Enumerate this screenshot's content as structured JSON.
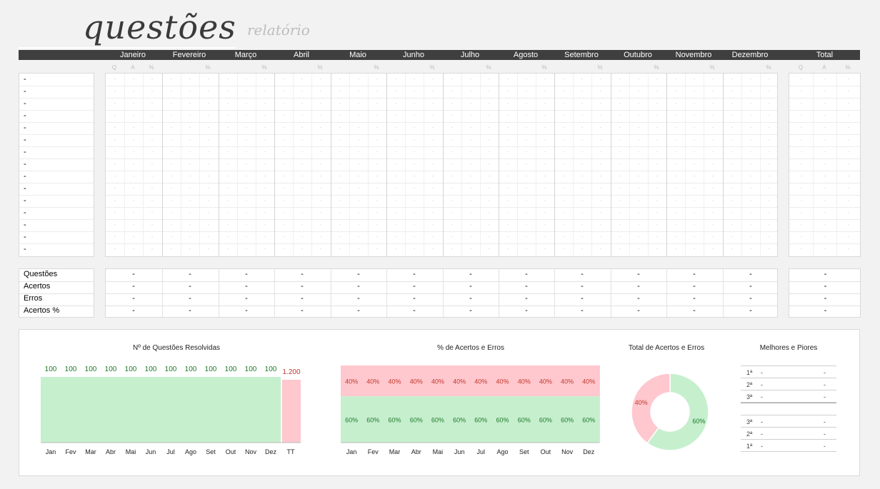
{
  "header": {
    "title": "questões",
    "subtitle": "relatório"
  },
  "months": [
    "Janeiro",
    "Fevereiro",
    "Março",
    "Abril",
    "Maio",
    "Junho",
    "Julho",
    "Agosto",
    "Setembro",
    "Outubro",
    "Novembro",
    "Dezembro",
    "Total"
  ],
  "sub_labels": {
    "q": "Q",
    "a": "A",
    "pct": "%"
  },
  "subjects": [
    "-",
    "-",
    "-",
    "-",
    "-",
    "-",
    "-",
    "-",
    "-",
    "-",
    "-",
    "-",
    "-",
    "-",
    "-"
  ],
  "empty_cell": "-",
  "summary": {
    "labels": [
      "Questões",
      "Acertos",
      "Erros",
      "Acertos %"
    ],
    "value": "-"
  },
  "dashboard": {
    "questions_chart": {
      "title": "Nº de Questões Resolvidas",
      "categories": [
        "Jan",
        "Fev",
        "Mar",
        "Abr",
        "Mai",
        "Jun",
        "Jul",
        "Ago",
        "Set",
        "Out",
        "Nov",
        "Dez",
        "TT"
      ]
    },
    "pct_chart": {
      "title": "% de Acertos e Erros",
      "categories": [
        "Jan",
        "Fev",
        "Mar",
        "Abr",
        "Mai",
        "Jun",
        "Jul",
        "Ago",
        "Set",
        "Out",
        "Nov",
        "Dez"
      ]
    },
    "donut_chart": {
      "title": "Total de Acertos e Erros"
    },
    "ranking": {
      "title": "Melhores e Piores",
      "best": [
        {
          "pos": "1ª",
          "name": "-",
          "value": "-"
        },
        {
          "pos": "2ª",
          "name": "-",
          "value": "-"
        },
        {
          "pos": "3ª",
          "name": "-",
          "value": "-"
        }
      ],
      "worst": [
        {
          "pos": "3ª",
          "name": "-",
          "value": "-"
        },
        {
          "pos": "2ª",
          "name": "-",
          "value": "-"
        },
        {
          "pos": "1ª",
          "name": "-",
          "value": "-"
        }
      ]
    }
  },
  "colors": {
    "dark": "#3f3f3f",
    "green": "#c6efce",
    "red": "#ffc7ce",
    "green_text": "#1f7a2a",
    "red_text": "#c0392b"
  },
  "chart_data": [
    {
      "type": "bar",
      "title": "Nº de Questões Resolvidas",
      "categories": [
        "Jan",
        "Fev",
        "Mar",
        "Abr",
        "Mai",
        "Jun",
        "Jul",
        "Ago",
        "Set",
        "Out",
        "Nov",
        "Dez",
        "TT"
      ],
      "values": [
        100,
        100,
        100,
        100,
        100,
        100,
        100,
        100,
        100,
        100,
        100,
        100,
        1200
      ],
      "value_labels": [
        "100",
        "100",
        "100",
        "100",
        "100",
        "100",
        "100",
        "100",
        "100",
        "100",
        "100",
        "100",
        "1.200"
      ]
    },
    {
      "type": "bar",
      "title": "% de Acertos e Erros",
      "categories": [
        "Jan",
        "Fev",
        "Mar",
        "Abr",
        "Mai",
        "Jun",
        "Jul",
        "Ago",
        "Set",
        "Out",
        "Nov",
        "Dez"
      ],
      "series": [
        {
          "values": [
            60,
            60,
            60,
            60,
            60,
            60,
            60,
            60,
            60,
            60,
            60,
            60
          ]
        },
        {
          "values": [
            40,
            40,
            40,
            40,
            40,
            40,
            40,
            40,
            40,
            40,
            40,
            40
          ]
        }
      ]
    },
    {
      "type": "pie",
      "title": "Total de Acertos e Erros",
      "values": [
        60,
        40
      ],
      "value_labels": [
        "60%",
        "40%"
      ]
    }
  ]
}
